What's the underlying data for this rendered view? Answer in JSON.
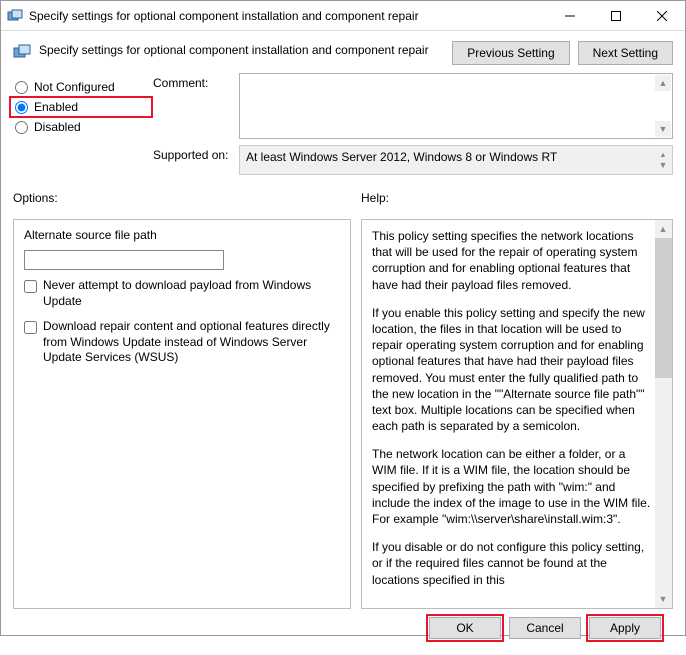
{
  "window": {
    "title": "Specify settings for optional component installation and component repair"
  },
  "header": {
    "title": "Specify settings for optional component installation and component repair",
    "prev_btn": "Previous Setting",
    "next_btn": "Next Setting"
  },
  "state": {
    "not_configured": "Not Configured",
    "enabled": "Enabled",
    "disabled": "Disabled",
    "selected": "enabled"
  },
  "fields": {
    "comment_label": "Comment:",
    "comment_value": "",
    "supported_label": "Supported on:",
    "supported_value": "At least Windows Server 2012, Windows 8 or Windows RT"
  },
  "sections": {
    "options": "Options:",
    "help": "Help:"
  },
  "options": {
    "alt_source_label": "Alternate source file path",
    "alt_source_value": "",
    "never_download": "Never attempt to download payload from Windows Update",
    "download_repair": "Download repair content and optional features directly from Windows Update instead of Windows Server Update Services (WSUS)"
  },
  "help": {
    "p1": "This policy setting specifies the network locations that will be used for the repair of operating system corruption and for enabling optional features that have had their payload files removed.",
    "p2": "If you enable this policy setting and specify the new location, the files in that location will be used to repair operating system corruption and for enabling optional features that have had their payload files removed. You must enter the fully qualified path to the new location in the \"\"Alternate source file path\"\" text box. Multiple locations can be specified when each path is separated by a semicolon.",
    "p3": "The network location can be either a folder, or a WIM file. If it is a WIM file, the location should be specified by prefixing the path with \"wim:\" and include the index of the image to use in the WIM file. For example \"wim:\\\\server\\share\\install.wim:3\".",
    "p4": "If you disable or do not configure this policy setting, or if the required files cannot be found at the locations specified in this"
  },
  "footer": {
    "ok": "OK",
    "cancel": "Cancel",
    "apply": "Apply"
  }
}
